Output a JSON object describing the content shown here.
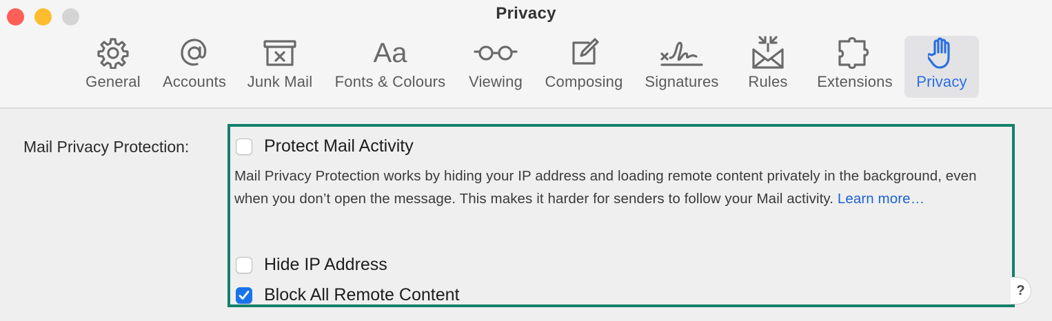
{
  "window": {
    "title": "Privacy"
  },
  "tabs": [
    {
      "id": "general",
      "label": "General",
      "icon": "gear-icon"
    },
    {
      "id": "accounts",
      "label": "Accounts",
      "icon": "at-icon"
    },
    {
      "id": "junk-mail",
      "label": "Junk Mail",
      "icon": "junk-tray-icon"
    },
    {
      "id": "fonts",
      "label": "Fonts & Colours",
      "icon": "fonts-icon",
      "glyph": "Aa"
    },
    {
      "id": "viewing",
      "label": "Viewing",
      "icon": "glasses-icon"
    },
    {
      "id": "composing",
      "label": "Composing",
      "icon": "compose-icon"
    },
    {
      "id": "signatures",
      "label": "Signatures",
      "icon": "signature-icon"
    },
    {
      "id": "rules",
      "label": "Rules",
      "icon": "rules-envelope-icon"
    },
    {
      "id": "extensions",
      "label": "Extensions",
      "icon": "puzzle-icon"
    },
    {
      "id": "privacy",
      "label": "Privacy",
      "icon": "hand-icon",
      "selected": true
    }
  ],
  "privacy": {
    "section_label": "Mail Privacy Protection:",
    "protect_mail_activity": {
      "label": "Protect Mail Activity",
      "checked": false
    },
    "description": "Mail Privacy Protection works by hiding your IP address and loading remote content privately in the background, even when you don’t open the message. This makes it harder for senders to follow your Mail activity.",
    "learn_more": "Learn more…",
    "hide_ip": {
      "label": "Hide IP Address",
      "checked": false
    },
    "block_remote": {
      "label": "Block All Remote Content",
      "checked": true
    },
    "help": "?"
  },
  "colors": {
    "accent": "#1a73e8",
    "highlight_border": "#13806a",
    "link": "#1c62d3"
  }
}
